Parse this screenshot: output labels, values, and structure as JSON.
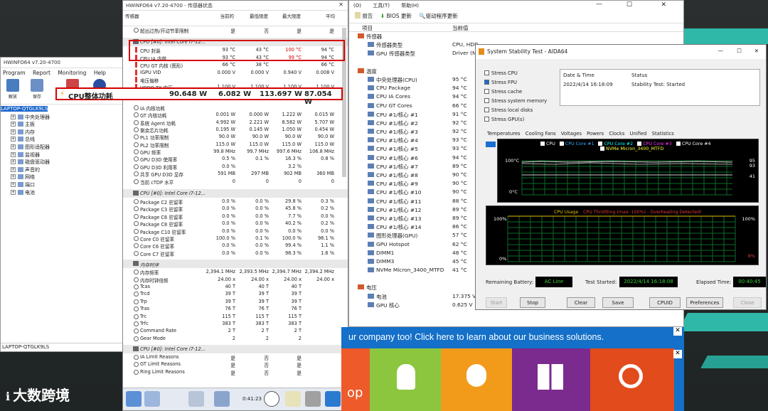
{
  "left_window": {
    "title": "HWiNFO64 v7.20-4700",
    "menu": [
      "Program",
      "Report",
      "Monitoring",
      "Help"
    ],
    "toolbar": [
      "解放",
      "保存",
      "",
      ""
    ],
    "tree": [
      "LAPTOP-QTGLK9LS",
      "中央处理器",
      "主板",
      "内存",
      "总线",
      "图形适配器",
      "监视器",
      "磁盘驱动器",
      "声音的",
      "网络",
      "端口",
      "电池"
    ],
    "status": "LAPTOP-QTGLK9LS"
  },
  "hwinfo": {
    "title": "HWiNFO64 v7.20-4700 - 传感器状态",
    "headers": [
      "传感器",
      "当前的",
      "最低限度",
      "最大限度",
      "平均"
    ],
    "rows_top": [
      {
        "n": "超出过热/开动节率限制",
        "a": "是",
        "b": "否",
        "c": "是",
        "d": "是"
      }
    ],
    "cpu_section": "CPU [#0]: Intel Core i7-12...",
    "rows_cpu": [
      {
        "n": "CPU 封装",
        "a": "93 °C",
        "b": "43 °C",
        "c": "100 °C",
        "d": "94 °C",
        "red": "c"
      },
      {
        "n": "CPU IA 内核",
        "a": "93 °C",
        "b": "43 °C",
        "c": "99 °C",
        "d": "94 °C",
        "red": "c"
      },
      {
        "n": "CPU GT 内核 (图形)",
        "a": "66 °C",
        "b": "38 °C",
        "c": "",
        "d": "66 °C"
      },
      {
        "n": "IGPU VID",
        "a": "0.000 V",
        "b": "0.000 V",
        "c": "0.940 V",
        "d": "0.008 V"
      },
      {
        "n": "电压偏移",
        "a": "",
        "b": "",
        "c": "",
        "d": ""
      },
      {
        "n": "VDDQ TX 电压",
        "a": "1.100 V",
        "b": "1.100 V",
        "c": "1.100 V",
        "d": "1.100 V"
      }
    ],
    "big_row": {
      "n": "CPU整体功耗",
      "a": "90.648 W",
      "b": "6.082 W",
      "c": "113.697 W",
      "d": "87.054 W"
    },
    "rows_pw": [
      {
        "n": "IA 内核功耗",
        "a": "",
        "b": "",
        "c": "",
        "d": ""
      },
      {
        "n": "GT 内核功耗",
        "a": "0.001 W",
        "b": "0.000 W",
        "c": "1.222 W",
        "d": "0.015 W"
      },
      {
        "n": "系统 Agent 功耗",
        "a": "4.992 W",
        "b": "2.221 W",
        "c": "8.582 W",
        "d": "5.707 W"
      },
      {
        "n": "剩余芯片功耗",
        "a": "0.195 W",
        "b": "0.145 W",
        "c": "1.050 W",
        "d": "0.454 W"
      },
      {
        "n": "PL1 功率限制",
        "a": "90.0 W",
        "b": "90.0 W",
        "c": "90.0 W",
        "d": "90.0 W"
      },
      {
        "n": "PL2 功率限制",
        "a": "115.0 W",
        "b": "115.0 W",
        "c": "115.0 W",
        "d": "115.0 W"
      },
      {
        "n": "GPU 频率",
        "a": "99.8 MHz",
        "b": "99.7 MHz",
        "c": "997.6 MHz",
        "d": "106.8 MHz"
      },
      {
        "n": "GPU D3D 使用率",
        "a": "0.5 %",
        "b": "0.1 %",
        "c": "16.3 %",
        "d": "0.8 %"
      },
      {
        "n": "GPU D3D 利用率",
        "a": "0.0 %",
        "b": "",
        "c": "3.2 %",
        "d": ""
      },
      {
        "n": "共享 GPU D3D 显存",
        "a": "591 MB",
        "b": "297 MB",
        "c": "902 MB",
        "d": "360 MB"
      },
      {
        "n": "当前 cTDP 水平",
        "a": "0",
        "b": "0",
        "c": "0",
        "d": "0"
      }
    ],
    "cst_section": "CPU [#0]: Intel Core i7-12...",
    "rows_cst": [
      {
        "n": "Package C2 驻留率",
        "a": "0.0 %",
        "b": "0.0 %",
        "c": "29.8 %",
        "d": "0.3 %"
      },
      {
        "n": "Package C3 驻留率",
        "a": "0.0 %",
        "b": "0.0 %",
        "c": "45.8 %",
        "d": "0.2 %"
      },
      {
        "n": "Package C6 驻留率",
        "a": "0.0 %",
        "b": "0.0 %",
        "c": "7.7 %",
        "d": "0.0 %"
      },
      {
        "n": "Package C8 驻留率",
        "a": "0.0 %",
        "b": "0.0 %",
        "c": "40.2 %",
        "d": "0.2 %"
      },
      {
        "n": "Package C10 驻留率",
        "a": "0.0 %",
        "b": "0.0 %",
        "c": "0.0 %",
        "d": "0.0 %"
      },
      {
        "n": "Core C0 驻留率",
        "a": "100.0 %",
        "b": "0.1 %",
        "c": "100.0 %",
        "d": "98.1 %"
      },
      {
        "n": "Core C6 驻留率",
        "a": "0.0 %",
        "b": "0.0 %",
        "c": "99.4 %",
        "d": "1.1 %"
      },
      {
        "n": "Core C7 驻留率",
        "a": "0.0 %",
        "b": "0.0 %",
        "c": "98.3 %",
        "d": "1.6 %"
      }
    ],
    "mem_section": "内存时序",
    "rows_mem": [
      {
        "n": "内存频率",
        "a": "2,394.1 MHz",
        "b": "2,393.5 MHz",
        "c": "2,394.7 MHz",
        "d": "2,394.2 MHz"
      },
      {
        "n": "内存时钟倍频",
        "a": "24.00 x",
        "b": "24.00 x",
        "c": "24.00 x",
        "d": "24.00 x"
      },
      {
        "n": "Tcas",
        "a": "40 T",
        "b": "40 T",
        "c": "40 T",
        "d": ""
      },
      {
        "n": "Trcd",
        "a": "39 T",
        "b": "39 T",
        "c": "39 T",
        "d": ""
      },
      {
        "n": "Trp",
        "a": "39 T",
        "b": "39 T",
        "c": "39 T",
        "d": ""
      },
      {
        "n": "Tras",
        "a": "76 T",
        "b": "76 T",
        "c": "76 T",
        "d": ""
      },
      {
        "n": "Trc",
        "a": "115 T",
        "b": "115 T",
        "c": "115 T",
        "d": ""
      },
      {
        "n": "Trfc",
        "a": "383 T",
        "b": "383 T",
        "c": "383 T",
        "d": ""
      },
      {
        "n": "Command Rate",
        "a": "2 T",
        "b": "2 T",
        "c": "2 T",
        "d": ""
      },
      {
        "n": "Gear Mode",
        "a": "2",
        "b": "2",
        "c": "2",
        "d": ""
      }
    ],
    "lim_section": "CPU [#0]: Intel Core i7-12...",
    "rows_lim": [
      {
        "n": "IA Limit Reasons",
        "a": "是",
        "b": "否",
        "c": "是",
        "d": ""
      },
      {
        "n": "GT Limit Reasons",
        "a": "是",
        "b": "否",
        "c": "是",
        "d": ""
      },
      {
        "n": "Ring Limit Reasons",
        "a": "是",
        "b": "否",
        "c": "是",
        "d": ""
      }
    ],
    "timer": "0:41:23"
  },
  "aida_main": {
    "menu": [
      "(O)",
      "工具(T)",
      "帮助(H)"
    ],
    "toolbar": [
      "报告",
      "BIOS 更新",
      "驱动程序更新"
    ],
    "headers": [
      "项目",
      "当前值"
    ],
    "rows": [
      {
        "l": "传感器",
        "v": "",
        "ind": 0
      },
      {
        "l": "传感器类型",
        "v": "CPU, HDD",
        "ind": 1
      },
      {
        "l": "GPU 传感器类型",
        "v": "Driver (N",
        "ind": 1
      },
      {
        "l": "",
        "v": "",
        "ind": 0
      },
      {
        "l": "温度",
        "v": "",
        "ind": 0
      },
      {
        "l": "中央处理器(CPU)",
        "v": "95 °C",
        "ind": 1
      },
      {
        "l": "CPU Package",
        "v": "94 °C",
        "ind": 1
      },
      {
        "l": "CPU IA Cores",
        "v": "94 °C",
        "ind": 1
      },
      {
        "l": "CPU GT Cores",
        "v": "66 °C",
        "ind": 1
      },
      {
        "l": "CPU #1/核心 #1",
        "v": "91 °C",
        "ind": 1
      },
      {
        "l": "CPU #1/核心 #2",
        "v": "92 °C",
        "ind": 1
      },
      {
        "l": "CPU #1/核心 #3",
        "v": "92 °C",
        "ind": 1
      },
      {
        "l": "CPU #1/核心 #4",
        "v": "93 °C",
        "ind": 1
      },
      {
        "l": "CPU #1/核心 #5",
        "v": "93 °C",
        "ind": 1
      },
      {
        "l": "CPU #1/核心 #6",
        "v": "94 °C",
        "ind": 1
      },
      {
        "l": "CPU #1/核心 #7",
        "v": "89 °C",
        "ind": 1
      },
      {
        "l": "CPU #1/核心 #8",
        "v": "90 °C",
        "ind": 1
      },
      {
        "l": "CPU #1/核心 #9",
        "v": "90 °C",
        "ind": 1
      },
      {
        "l": "CPU #1/核心 #10",
        "v": "90 °C",
        "ind": 1
      },
      {
        "l": "CPU #1/核心 #11",
        "v": "88 °C",
        "ind": 1
      },
      {
        "l": "CPU #1/核心 #12",
        "v": "89 °C",
        "ind": 1
      },
      {
        "l": "CPU #1/核心 #13",
        "v": "89 °C",
        "ind": 1
      },
      {
        "l": "CPU #1/核心 #14",
        "v": "86 °C",
        "ind": 1
      },
      {
        "l": "图形处理器(GPU)",
        "v": "57 °C",
        "ind": 1
      },
      {
        "l": "GPU Hotspot",
        "v": "62 °C",
        "ind": 1
      },
      {
        "l": "DIMM1",
        "v": "48 °C",
        "ind": 1
      },
      {
        "l": "DIMM3",
        "v": "45 °C",
        "ind": 1
      },
      {
        "l": "NVMe Micron_3400_MTFD",
        "v": "41 °C",
        "ind": 1
      },
      {
        "l": "",
        "v": "",
        "ind": 0
      },
      {
        "l": "电压",
        "v": "",
        "ind": 0
      },
      {
        "l": "电池",
        "v": "17.375 V",
        "ind": 1
      },
      {
        "l": "GPU 核心",
        "v": "0.625 V",
        "ind": 1
      }
    ]
  },
  "aida_stress": {
    "title": "System Stability Test - AIDA64",
    "checks": [
      {
        "l": "Stress CPU",
        "on": false
      },
      {
        "l": "Stress FPU",
        "on": true
      },
      {
        "l": "Stress cache",
        "on": false
      },
      {
        "l": "Stress system memory",
        "on": false
      },
      {
        "l": "Stress local disks",
        "on": false
      },
      {
        "l": "Stress GPU(s)",
        "on": false
      }
    ],
    "status_headers": [
      "Date & Time",
      "Status"
    ],
    "status_row": [
      "2022/4/14 16:18:09",
      "Stability Test: Started"
    ],
    "tabs": [
      "Temperatures",
      "Cooling Fans",
      "Voltages",
      "Powers",
      "Clocks",
      "Unified",
      "Statistics"
    ],
    "legend": [
      "CPU",
      "CPU Core #1",
      "CPU Core #2",
      "CPU Core #3",
      "CPU Core #4",
      "NVMe Micron_3400_MTFD"
    ],
    "g1": {
      "top": "100°C",
      "bottom": "0°C",
      "r1": "95",
      "r2": "93",
      "r3": "41"
    },
    "g2": {
      "title1": "CPU Usage",
      "title2": "CPU Throttling (max: 100%) - Overheating Detected!",
      "top": "100%",
      "bottom": "0%",
      "rt": "100%",
      "rb": "8%"
    },
    "battery_label": "Remaining Battery:",
    "battery": "AC Line",
    "started_label": "Test Started:",
    "started": "2022/4/14 16:18:08",
    "elapsed_label": "Elapsed Time:",
    "elapsed": "00:40:45",
    "buttons": [
      "Start",
      "Stop",
      "Clear",
      "Save",
      "CPUID",
      "Preferences",
      "Close"
    ]
  },
  "ad": {
    "text": "ur company too! Click here to learn about our business solutions.",
    "left": "op"
  },
  "watermark": "大数跨境",
  "colors": {
    "red": "#d40000",
    "teal": "#2fb8a8",
    "graph_green": "#0a6b2a",
    "ad_blue": "#1470c8"
  }
}
